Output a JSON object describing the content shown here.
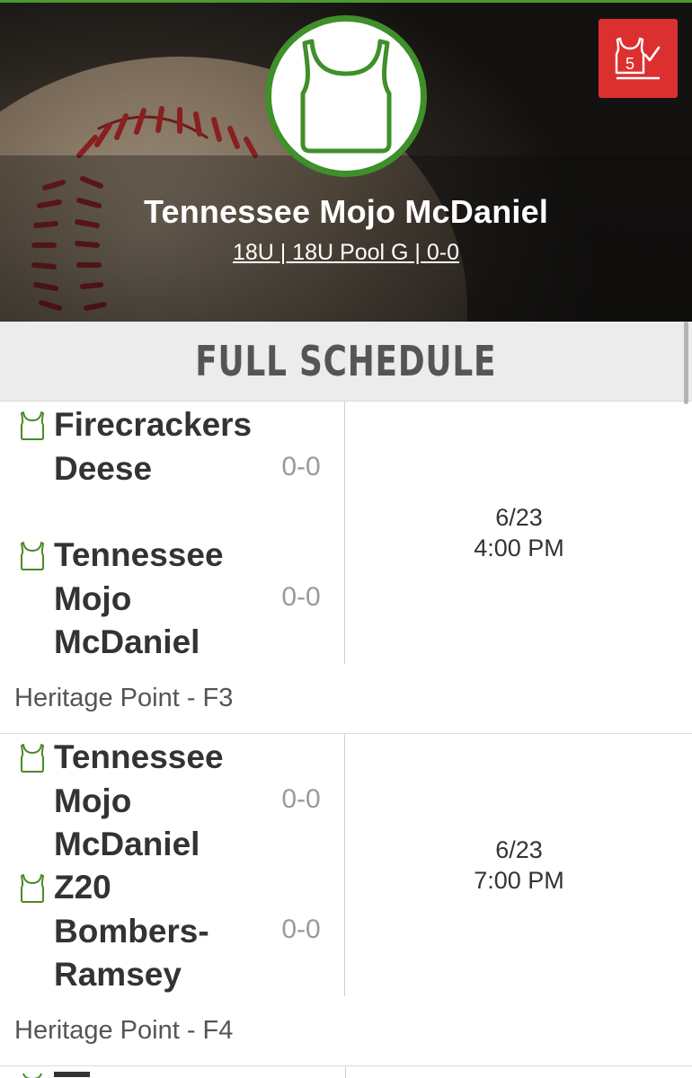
{
  "team": {
    "name": "Tennessee Mojo McDaniel",
    "subtitle": "18U | 18U Pool G | 0-0"
  },
  "section": {
    "title": "FULL SCHEDULE"
  },
  "header_button": {
    "icon": "jersey-checklist-icon",
    "badge": "5"
  },
  "colors": {
    "accent_green": "#3f8f2a",
    "button_red": "#dc3030"
  },
  "games": [
    {
      "teams": [
        {
          "name": "Firecrackers Deese",
          "record": "0-0"
        },
        {
          "name": "Tennessee Mojo McDaniel",
          "record": "0-0"
        }
      ],
      "date": "6/23",
      "time": "4:00 PM",
      "venue": "Heritage Point - F3"
    },
    {
      "teams": [
        {
          "name": "Tennessee Mojo McDaniel",
          "record": "0-0"
        },
        {
          "name": "Z20 Bombers-Ramsey",
          "record": "0-0"
        }
      ],
      "date": "6/23",
      "time": "7:00 PM",
      "venue": "Heritage Point - F4"
    }
  ]
}
